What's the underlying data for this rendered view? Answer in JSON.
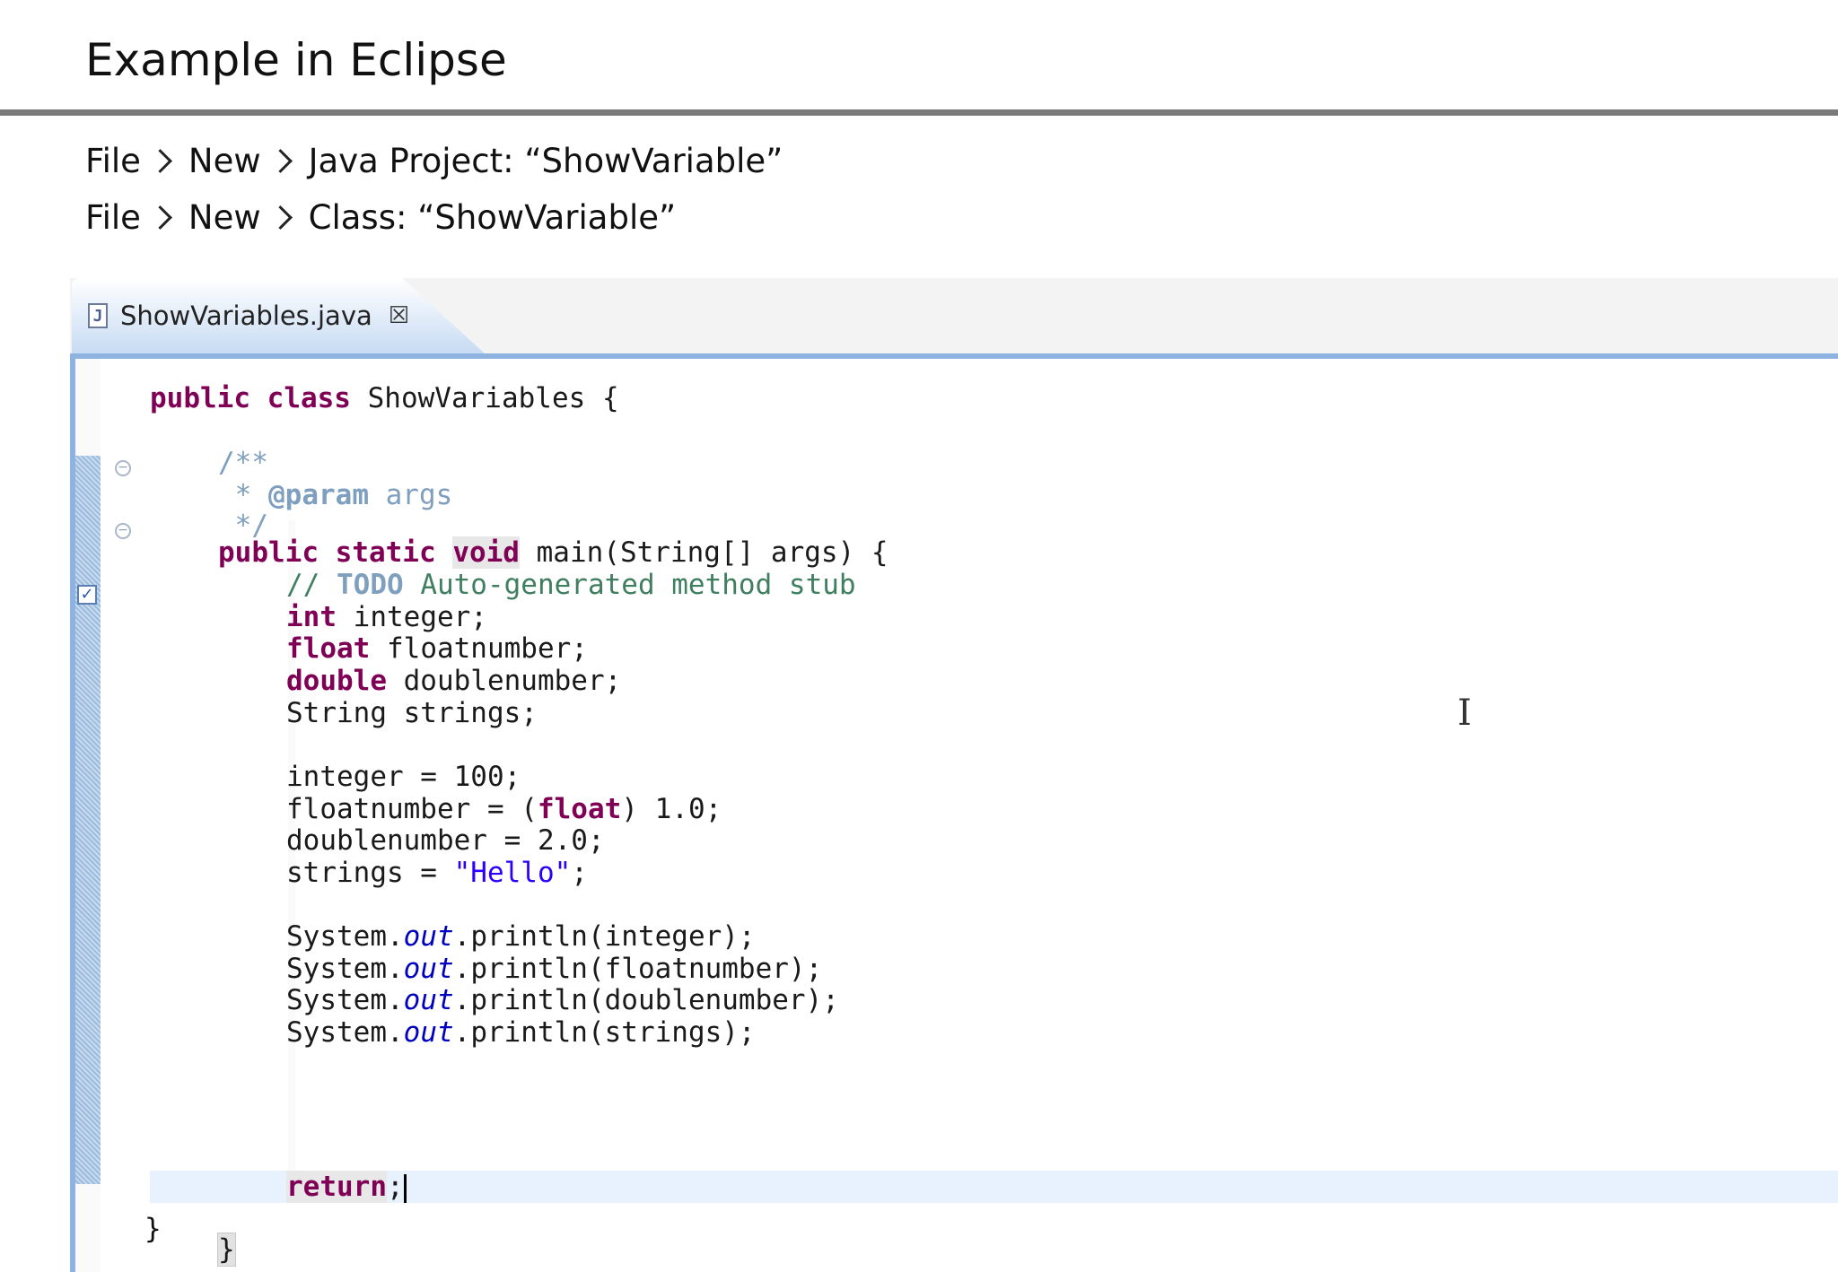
{
  "slide": {
    "title": "Example in Eclipse",
    "steps": [
      {
        "parts": [
          "File",
          "New",
          "Java Project: “ShowVariable”"
        ]
      },
      {
        "parts": [
          "File",
          "New",
          "Class: “ShowVariable”"
        ]
      }
    ]
  },
  "editor": {
    "tab": {
      "icon_letter": "J",
      "filename": "ShowVariables.java",
      "close_glyph": "☒"
    },
    "code": {
      "class_line": {
        "kw1": "public",
        "kw2": "class",
        "rest": " ShowVariables {"
      },
      "doc_open": "/**",
      "doc_param_prefix": " * ",
      "doc_param_tag": "@param",
      "doc_param_rest": " args",
      "doc_close": " */",
      "main_line": {
        "kw1": "public",
        "kw2": "static",
        "kw3": "void",
        "rest": " main(String[] args) {"
      },
      "todo_prefix": "// ",
      "todo_tag": "TODO",
      "todo_rest": " Auto-generated method stub",
      "decl_int": {
        "kw": "int",
        "rest": " integer;"
      },
      "decl_float": {
        "kw": "float",
        "rest": " floatnumber;"
      },
      "decl_double": {
        "kw": "double",
        "rest": " doublenumber;"
      },
      "decl_string": "String strings;",
      "assign_int": "integer = 100;",
      "assign_float": {
        "pre": "floatnumber = (",
        "kw": "float",
        "post": ") 1.0;"
      },
      "assign_double": "doublenumber = 2.0;",
      "assign_string": {
        "pre": "strings = ",
        "str": "\"Hello\"",
        "post": ";"
      },
      "print_prefix": "System.",
      "print_field": "out",
      "print_lines": [
        ".println(integer);",
        ".println(floatnumber);",
        ".println(doublenumber);",
        ".println(strings);"
      ],
      "return_kw": "return",
      "return_rest": ";",
      "method_close": "}",
      "class_close": "}"
    },
    "gutter": {
      "fold_glyph": "−",
      "task_glyph": "✓"
    },
    "cursor_glyph": "I"
  },
  "colors": {
    "keyword": "#7f0055",
    "javadoc": "#7f9fbf",
    "comment": "#3f7f5f",
    "string": "#2a00ff",
    "field": "#0000c0",
    "tab_border": "#8fb3e0"
  }
}
